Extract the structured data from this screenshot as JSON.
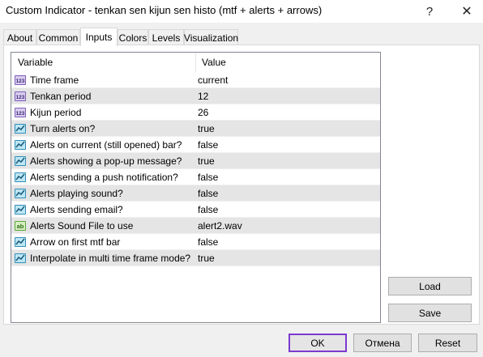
{
  "window": {
    "title": "Custom Indicator - tenkan sen kijun sen histo (mtf + alerts  + arrows)",
    "help_glyph": "?",
    "close_glyph": "✕"
  },
  "tabs": [
    {
      "label": "About"
    },
    {
      "label": "Common"
    },
    {
      "label": "Inputs"
    },
    {
      "label": "Colors"
    },
    {
      "label": "Levels"
    },
    {
      "label": "Visualization"
    }
  ],
  "active_tab": "Inputs",
  "grid": {
    "col_variable": "Variable",
    "col_value": "Value",
    "rows": [
      {
        "icon": "int-icon",
        "name": "Time frame",
        "value": "current"
      },
      {
        "icon": "int-icon",
        "name": "Tenkan period",
        "value": "12"
      },
      {
        "icon": "int-icon",
        "name": "Kijun period",
        "value": "26"
      },
      {
        "icon": "bool-icon",
        "name": "Turn alerts on?",
        "value": "true"
      },
      {
        "icon": "bool-icon",
        "name": "Alerts on current (still opened) bar?",
        "value": "false"
      },
      {
        "icon": "bool-icon",
        "name": "Alerts showing a pop-up message?",
        "value": "true"
      },
      {
        "icon": "bool-icon",
        "name": "Alerts sending a push notification?",
        "value": "false"
      },
      {
        "icon": "bool-icon",
        "name": "Alerts playing sound?",
        "value": "false"
      },
      {
        "icon": "bool-icon",
        "name": "Alerts sending email?",
        "value": "false"
      },
      {
        "icon": "string-icon",
        "name": "Alerts Sound File to use",
        "value": "alert2.wav"
      },
      {
        "icon": "bool-icon",
        "name": "Arrow on first mtf bar",
        "value": "false"
      },
      {
        "icon": "bool-icon",
        "name": "Interpolate in multi time frame mode?",
        "value": "true"
      }
    ]
  },
  "side_buttons": {
    "load": "Load",
    "save": "Save"
  },
  "footer": {
    "ok": "OK",
    "cancel": "Отмена",
    "reset": "Reset"
  },
  "colors": {
    "accent": "#7c3ad0",
    "alt_row": "#e5e5e5"
  }
}
